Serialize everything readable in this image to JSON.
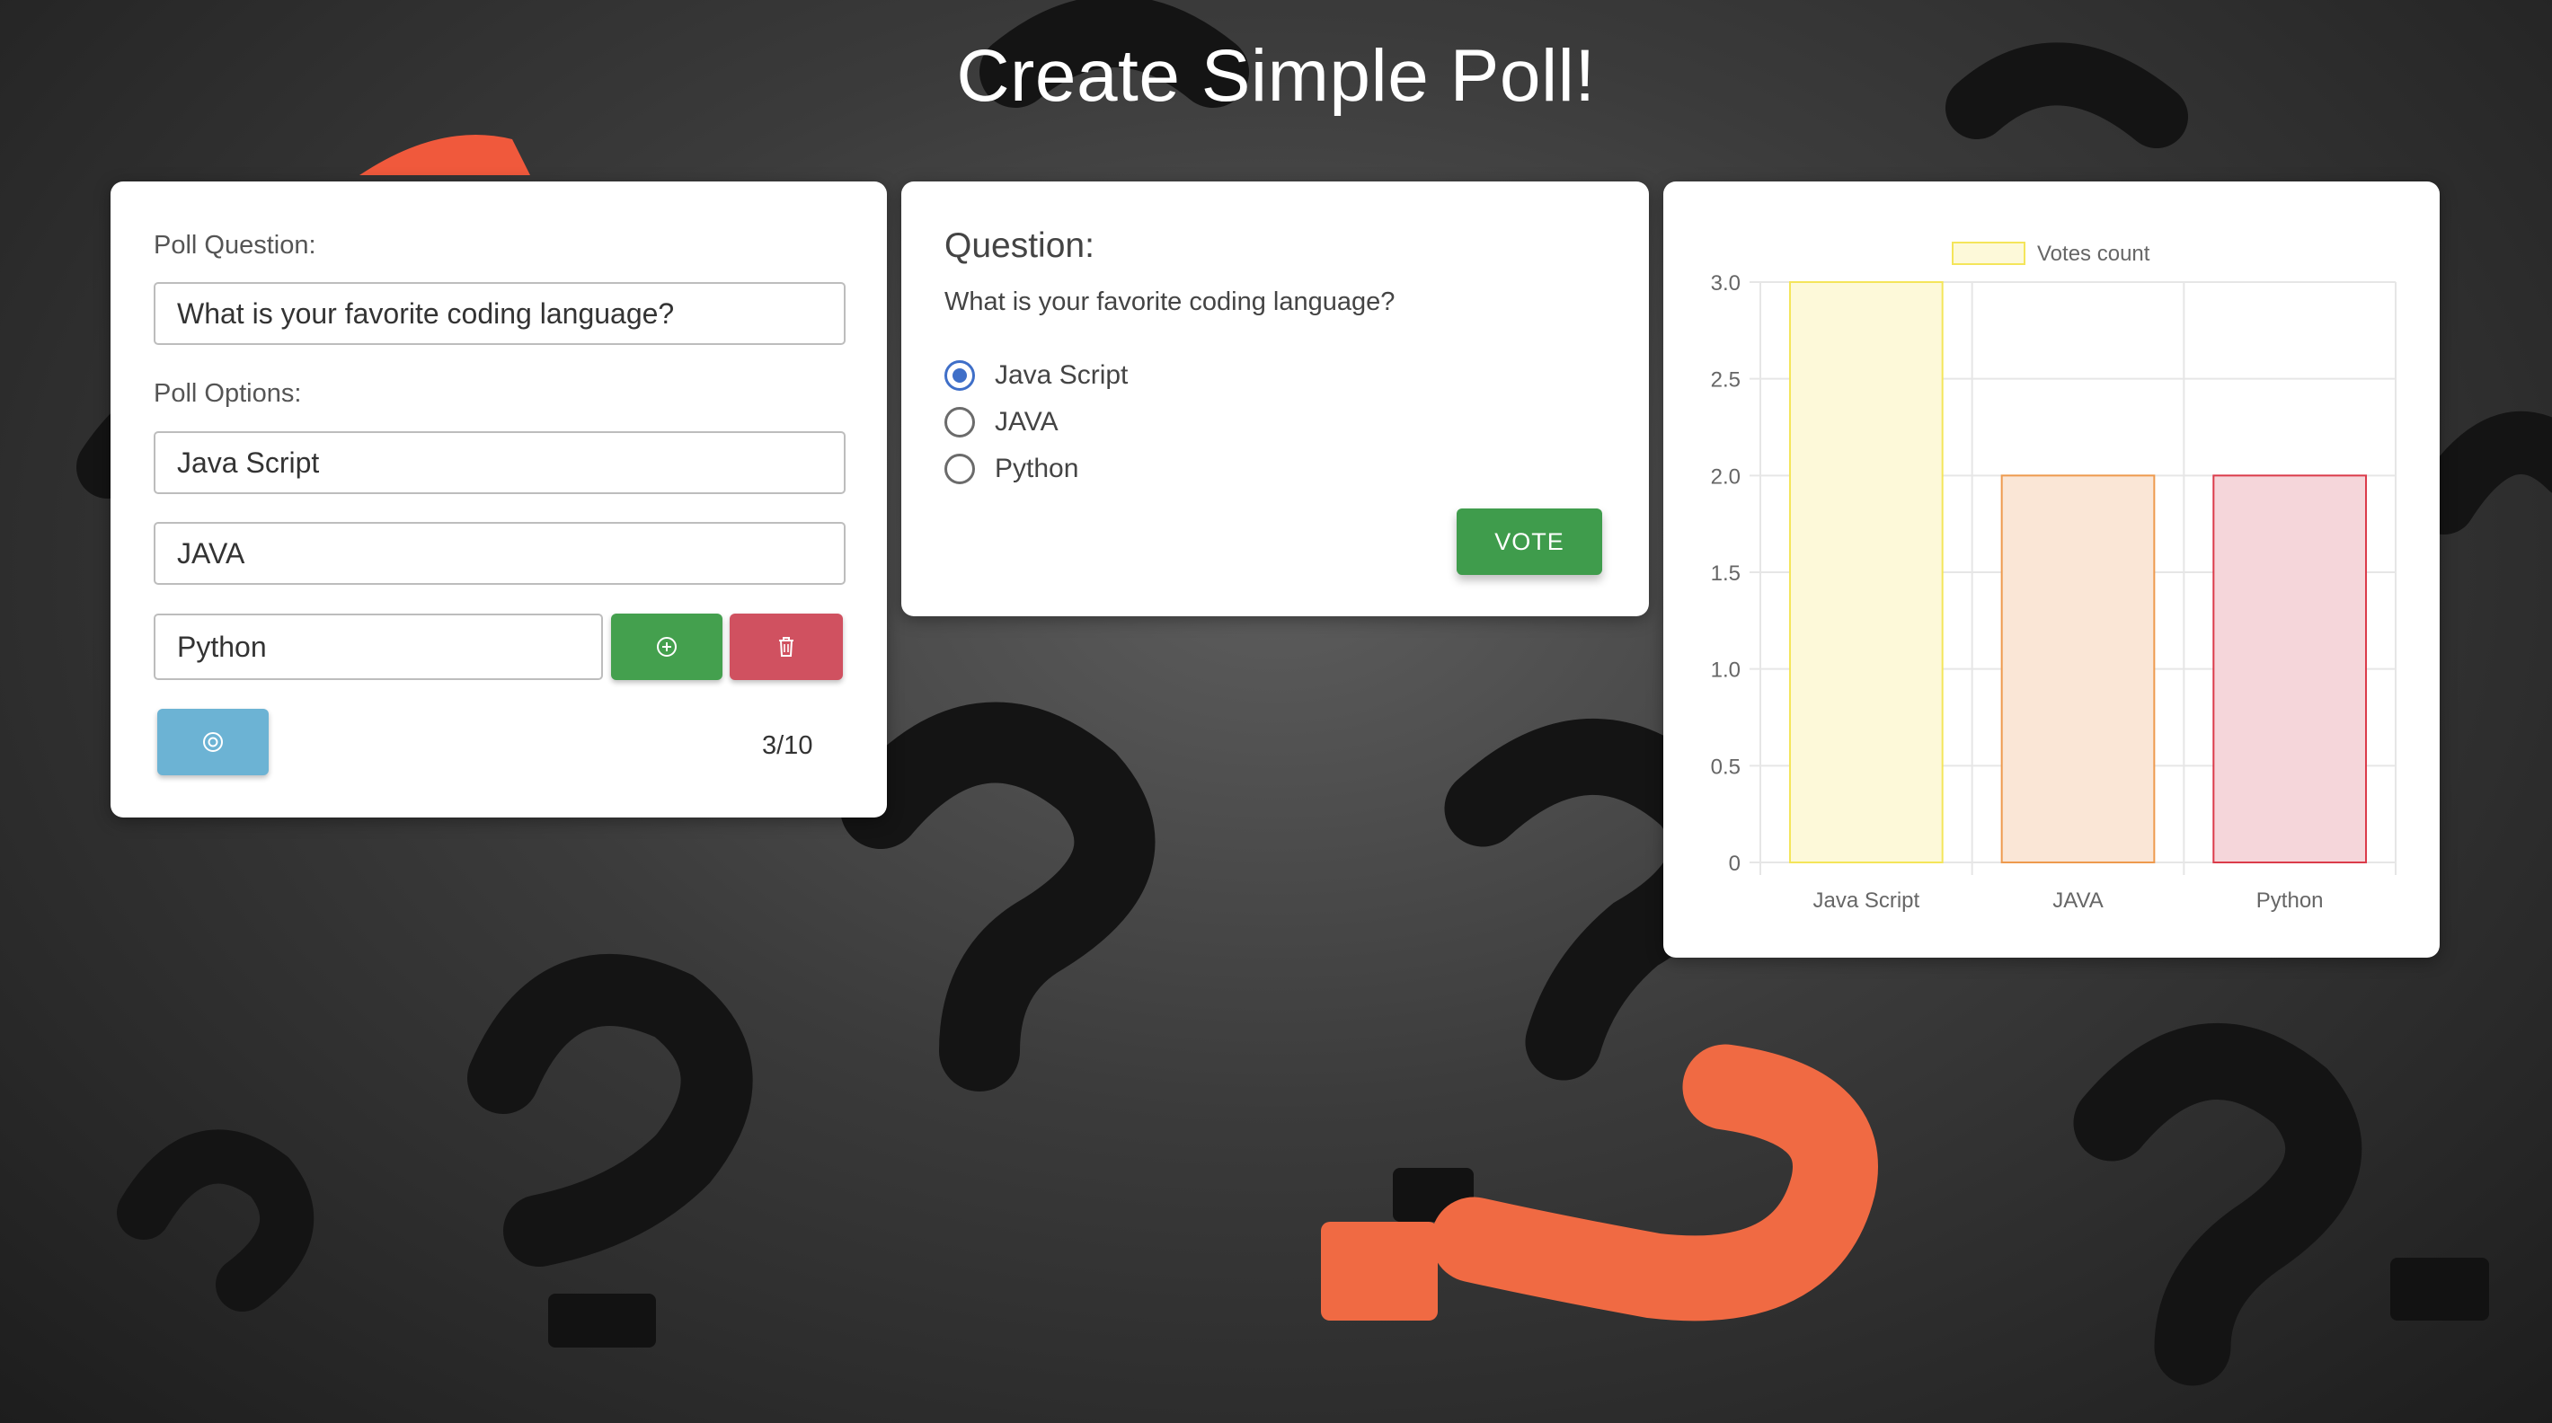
{
  "page": {
    "title": "Create Simple Poll!"
  },
  "editor": {
    "question_label": "Poll Question:",
    "question_value": "What is your favorite coding language?",
    "options_label": "Poll Options:",
    "options": [
      "Java Script",
      "JAVA",
      "Python"
    ],
    "count": "3/10"
  },
  "voter": {
    "heading": "Question:",
    "question": "What is your favorite coding language?",
    "options": [
      "Java Script",
      "JAVA",
      "Python"
    ],
    "selected_index": 0,
    "vote_label": "VOTE"
  },
  "chart_data": {
    "type": "bar",
    "categories": [
      "Java Script",
      "JAVA",
      "Python"
    ],
    "series": [
      {
        "name": "Votes count",
        "values": [
          3,
          2,
          2
        ]
      }
    ],
    "ylim": [
      0,
      3
    ],
    "yticks": [
      0,
      0.5,
      1.0,
      1.5,
      2.0,
      2.5,
      3.0
    ],
    "ytick_labels": [
      "0",
      "0.5",
      "1.0",
      "1.5",
      "2.0",
      "2.5",
      "3.0"
    ],
    "grid": true,
    "legend": "top",
    "colors": {
      "fill": [
        "#fdf9d9",
        "#fae6d6",
        "#f5d6da"
      ],
      "stroke": [
        "#f4e55a",
        "#ee9a4e",
        "#db3b4a"
      ],
      "grid": "#e6e6e6",
      "text": "#666666"
    }
  }
}
